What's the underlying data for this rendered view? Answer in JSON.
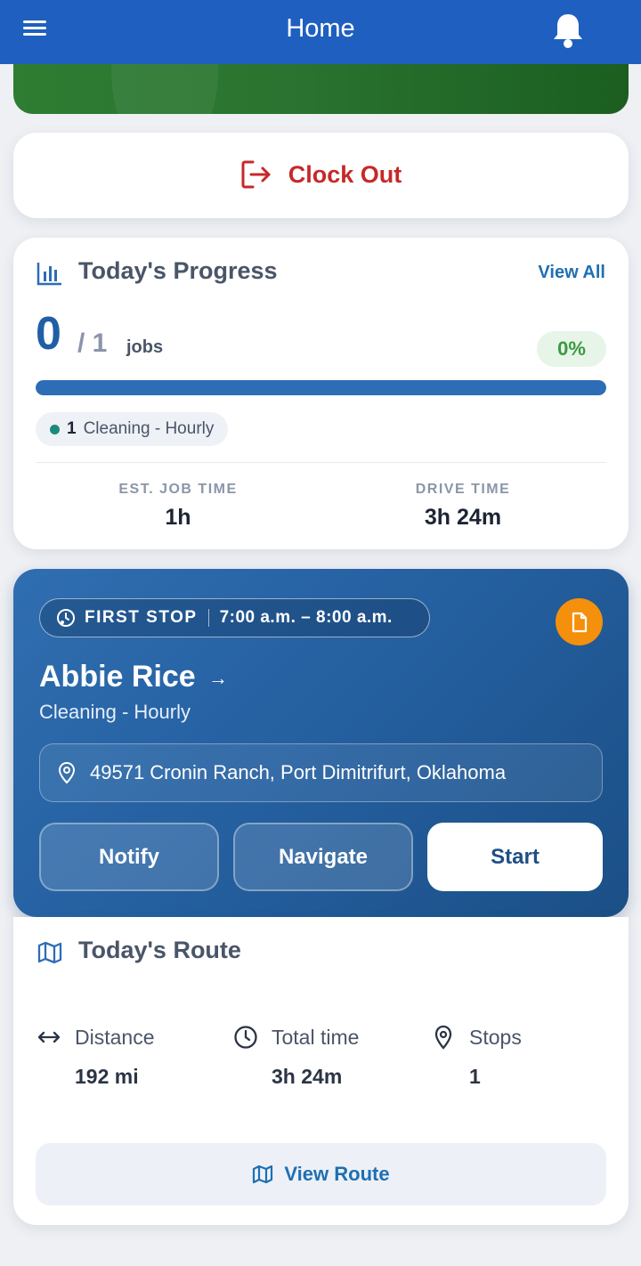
{
  "header": {
    "title": "Home"
  },
  "clock": {
    "label": "Clock Out"
  },
  "progress": {
    "title": "Today's Progress",
    "view_all": "View All",
    "completed": "0",
    "total": "/ 1",
    "unit": "jobs",
    "percent_label": "0%",
    "bar_fill_fraction": 1.0,
    "chip": {
      "count": "1",
      "label": "Cleaning - Hourly",
      "dot_color": "#1a8a7e"
    },
    "stats": [
      {
        "label": "EST. JOB TIME",
        "value": "1h"
      },
      {
        "label": "DRIVE TIME",
        "value": "3h 24m"
      }
    ]
  },
  "stop": {
    "badge": "FIRST STOP",
    "time": "7:00 a.m. – 8:00 a.m.",
    "customer": "Abbie Rice",
    "arrow": "→",
    "service": "Cleaning - Hourly",
    "address": "49571 Cronin Ranch, Port Dimitrifurt, Oklahoma",
    "buttons": {
      "notify": "Notify",
      "navigate": "Navigate",
      "start": "Start"
    }
  },
  "route": {
    "title": "Today's Route",
    "items": [
      {
        "label": "Distance",
        "value": "192 mi",
        "icon": "arrows-horizontal-icon"
      },
      {
        "label": "Total time",
        "value": "3h 24m",
        "icon": "clock-icon"
      },
      {
        "label": "Stops",
        "value": "1",
        "icon": "map-pin-icon"
      }
    ],
    "view_route": "View Route"
  },
  "colors": {
    "header": "#1f5fbf",
    "clock_out": "#c62828",
    "accent": "#1f6fb2",
    "success": "#3a9a3f",
    "note_button": "#f5900c"
  }
}
